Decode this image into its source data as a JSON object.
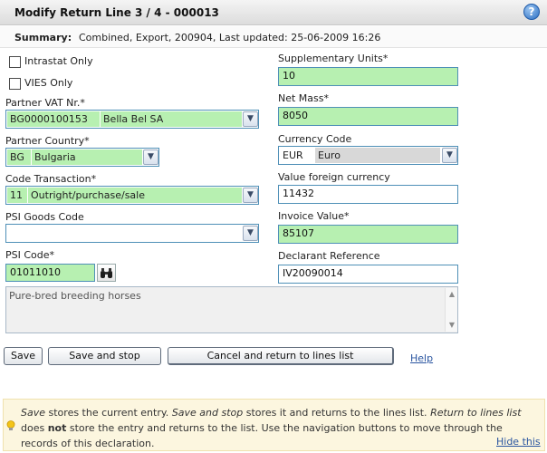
{
  "header": {
    "title": "Modify Return Line 3 / 4 - 000013",
    "help_icon": "question-icon"
  },
  "summary": {
    "label": "Summary:",
    "value": "Combined, Export, 200904, Last updated: 25-06-2009 16:26"
  },
  "form": {
    "intrastat_only": {
      "label": "Intrastat Only",
      "checked": false
    },
    "vies_only": {
      "label": "VIES Only",
      "checked": false
    },
    "partner_vat": {
      "label": "Partner VAT Nr.*",
      "code": "BG0000100153",
      "name": "Bella Bel SA"
    },
    "partner_country": {
      "label": "Partner Country*",
      "code": "BG",
      "name": "Bulgaria"
    },
    "code_transaction": {
      "label": "Code Transaction*",
      "code": "11",
      "name": "Outright/purchase/sale"
    },
    "psi_goods_code": {
      "label": "PSI Goods Code",
      "value": ""
    },
    "psi_code": {
      "label": "PSI Code*",
      "value": "01011010",
      "lookup_icon": "binoculars-icon"
    },
    "supplementary_units": {
      "label": "Supplementary Units*",
      "value": "10"
    },
    "net_mass": {
      "label": "Net Mass*",
      "value": "8050"
    },
    "currency_code": {
      "label": "Currency Code",
      "code": "EUR",
      "name": "Euro"
    },
    "value_foreign_currency": {
      "label": "Value foreign currency",
      "value": "11432"
    },
    "invoice_value": {
      "label": "Invoice Value*",
      "value": "85107"
    },
    "declarant_reference": {
      "label": "Declarant Reference",
      "value": "IV20090014"
    },
    "description": "Pure-bred breeding horses"
  },
  "buttons": {
    "save": "Save",
    "save_and_stop": "Save and stop",
    "cancel": "Cancel and return to lines list",
    "help": "Help"
  },
  "info": {
    "p1": "Save",
    "p2": " stores the current entry. ",
    "p3": "Save and stop",
    "p4": " stores it and returns to the lines list. ",
    "p5": "Return to lines list",
    "p6": " does ",
    "p7": "not",
    "p8": " store the entry and returns to the list. Use the navigation buttons to move through the records of this declaration.",
    "hide": "Hide this",
    "icon": "lightbulb-icon"
  },
  "colors": {
    "required_field": "#b7f0b1",
    "field_border": "#4f90b7",
    "link": "#2a55a0",
    "info_background": "#fcf6df"
  }
}
